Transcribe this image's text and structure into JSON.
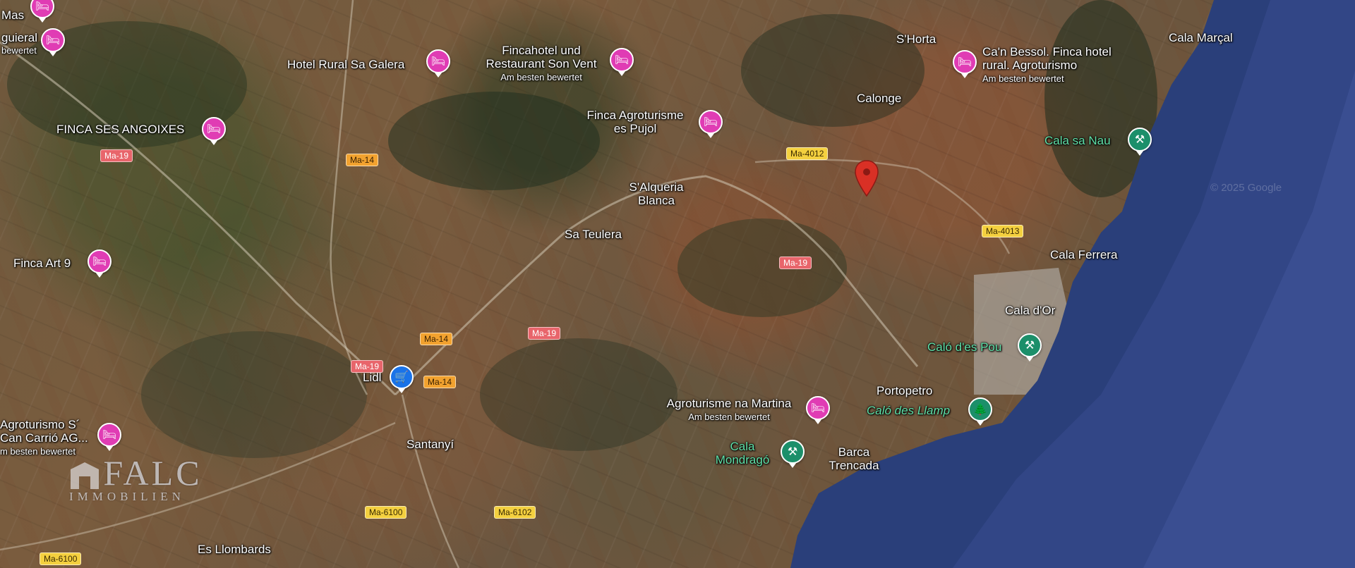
{
  "map": {
    "view": "satellite",
    "accent_colors": {
      "hotel": "#e03cb4",
      "park": "#1c8f6a",
      "shopping": "#1a73e8",
      "location_pin": "#d93025"
    }
  },
  "places": {
    "mas": "Mas",
    "guieral": "guieral",
    "guieral_sub": "bewertet",
    "hotel_sa_galera": "Hotel Rural Sa Galera",
    "fincahotel_l1": "Fincahotel und",
    "fincahotel_l2": "Restaurant Son Vent",
    "fincahotel_sub": "Am besten bewertet",
    "shorta": "S'Horta",
    "canbessol_l1": "Ca'n Bessol. Finca hotel",
    "canbessol_l2": "rural. Agroturismo",
    "canbessol_sub": "Am besten bewertet",
    "cala_marcal": "Cala Marçal",
    "finca_ses_angoixes": "FINCA SES ANGOIXES",
    "calonge": "Calonge",
    "pujol_l1": "Finca Agroturisme",
    "pujol_l2": "es Pujol",
    "cala_sa_nau": "Cala sa Nau",
    "salqueria_l1": "S'Alqueria",
    "salqueria_l2": "Blanca",
    "sa_teulera": "Sa Teulera",
    "cala_ferrera": "Cala Ferrera",
    "finca_art9": "Finca Art 9",
    "cala_dor": "Cala d'Or",
    "calo_des_pou": "Caló d'es Pou",
    "lidl": "Lidl",
    "portopetro": "Portopetro",
    "calo_des_llamp": "Caló des Llamp",
    "agro_na_martina": "Agroturisme na Martina",
    "agro_na_martina_sub": "Am besten bewertet",
    "agro_can_carrio_l1": "Agroturismo S´",
    "agro_can_carrio_l2": "Can Carrió AG...",
    "agro_can_carrio_sub": "m besten bewertet",
    "santanyi": "Santanyí",
    "cala_mondrago_l1": "Cala",
    "cala_mondrago_l2": "Mondragó",
    "barca_trencada_l1": "Barca",
    "barca_trencada_l2": "Trencada",
    "es_llombards": "Es Llombards"
  },
  "roads": {
    "ma19_a": "Ma-19",
    "ma14_a": "Ma-14",
    "ma4012": "Ma-4012",
    "ma4013": "Ma-4013",
    "ma19_b": "Ma-19",
    "ma19_c": "Ma-19",
    "ma14_b": "Ma-14",
    "ma19_d": "Ma-19",
    "ma14_c": "Ma-14",
    "ma6100_a": "Ma-6100",
    "ma6102": "Ma-6102",
    "ma6100_b": "Ma-6100"
  },
  "icons": {
    "hotel": "bed-icon",
    "park": "park-icon",
    "shop": "shopping-cart-icon",
    "pin": "map-pin-icon"
  },
  "watermark": {
    "brand": "FALC",
    "sub": "IMMOBILIEN",
    "google": "© 2025 Google"
  }
}
